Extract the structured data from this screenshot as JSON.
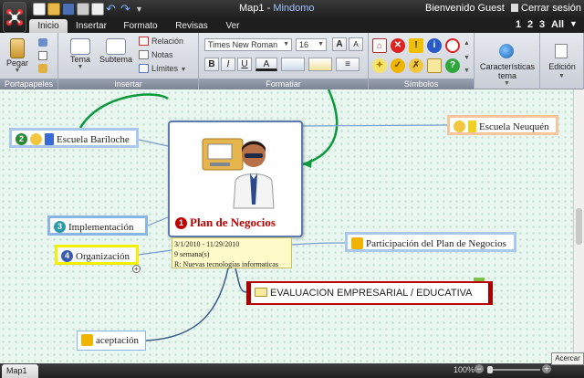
{
  "window": {
    "title": "Map1",
    "separator": " - ",
    "app_name": "Mindomo"
  },
  "account": {
    "welcome": "Bienvenido Guest",
    "logout": "Cerrar sesión"
  },
  "tabs": [
    {
      "label": "Inicio",
      "active": true
    },
    {
      "label": "Insertar"
    },
    {
      "label": "Formato"
    },
    {
      "label": "Revisas"
    },
    {
      "label": "Ver"
    }
  ],
  "view_levels": [
    "1",
    "2",
    "3",
    "All"
  ],
  "ribbon": {
    "groups": {
      "portapapeles": "Portapapeles",
      "insertar": "Insertar",
      "formatiar": "Formatiar",
      "simbolos": "Símbolos"
    },
    "paste_label": "Pegar",
    "tema_label": "Tema",
    "subtema_label": "Subtema",
    "relacion_label": "Relación",
    "notas_label": "Notas",
    "limites_label": "Límites",
    "font_family": "Times New Roman",
    "font_size": "16",
    "grow_font": "A",
    "shrink_font": "A",
    "bold": "B",
    "italic": "I",
    "underline": "U",
    "font_color": "A",
    "caracteristicas_label": "Características tema",
    "edicion_label": "Edición"
  },
  "map": {
    "central": {
      "number": "1",
      "title": "Plan de Negocios",
      "note": [
        "3/1/2010 - 11/29/2010",
        "9 semana(s)",
        "R: Nuevas tecnologías informaticas"
      ]
    },
    "topics": {
      "bariloche": {
        "number": "2",
        "label": "Escuela Bariloche"
      },
      "neuquen": {
        "label": "Escuela Neuquén"
      },
      "implementacion": {
        "number": "3",
        "label": "Implementación"
      },
      "organizacion": {
        "number": "4",
        "label": "Organización"
      },
      "participacion": {
        "label": "Participación del Plan de Negocios"
      },
      "evaluacion": {
        "label": "EVALUACION EMPRESARIAL / EDUCATIVA"
      },
      "aceptacion": {
        "label": "aceptación"
      }
    }
  },
  "status": {
    "map_tab": "Map1",
    "zoom": "100%",
    "tooltip": "Acercar"
  },
  "colors": {
    "accent_red": "#c00000",
    "relation_green": "#0a9a3c",
    "topic_blue": "#a8c8ef"
  }
}
